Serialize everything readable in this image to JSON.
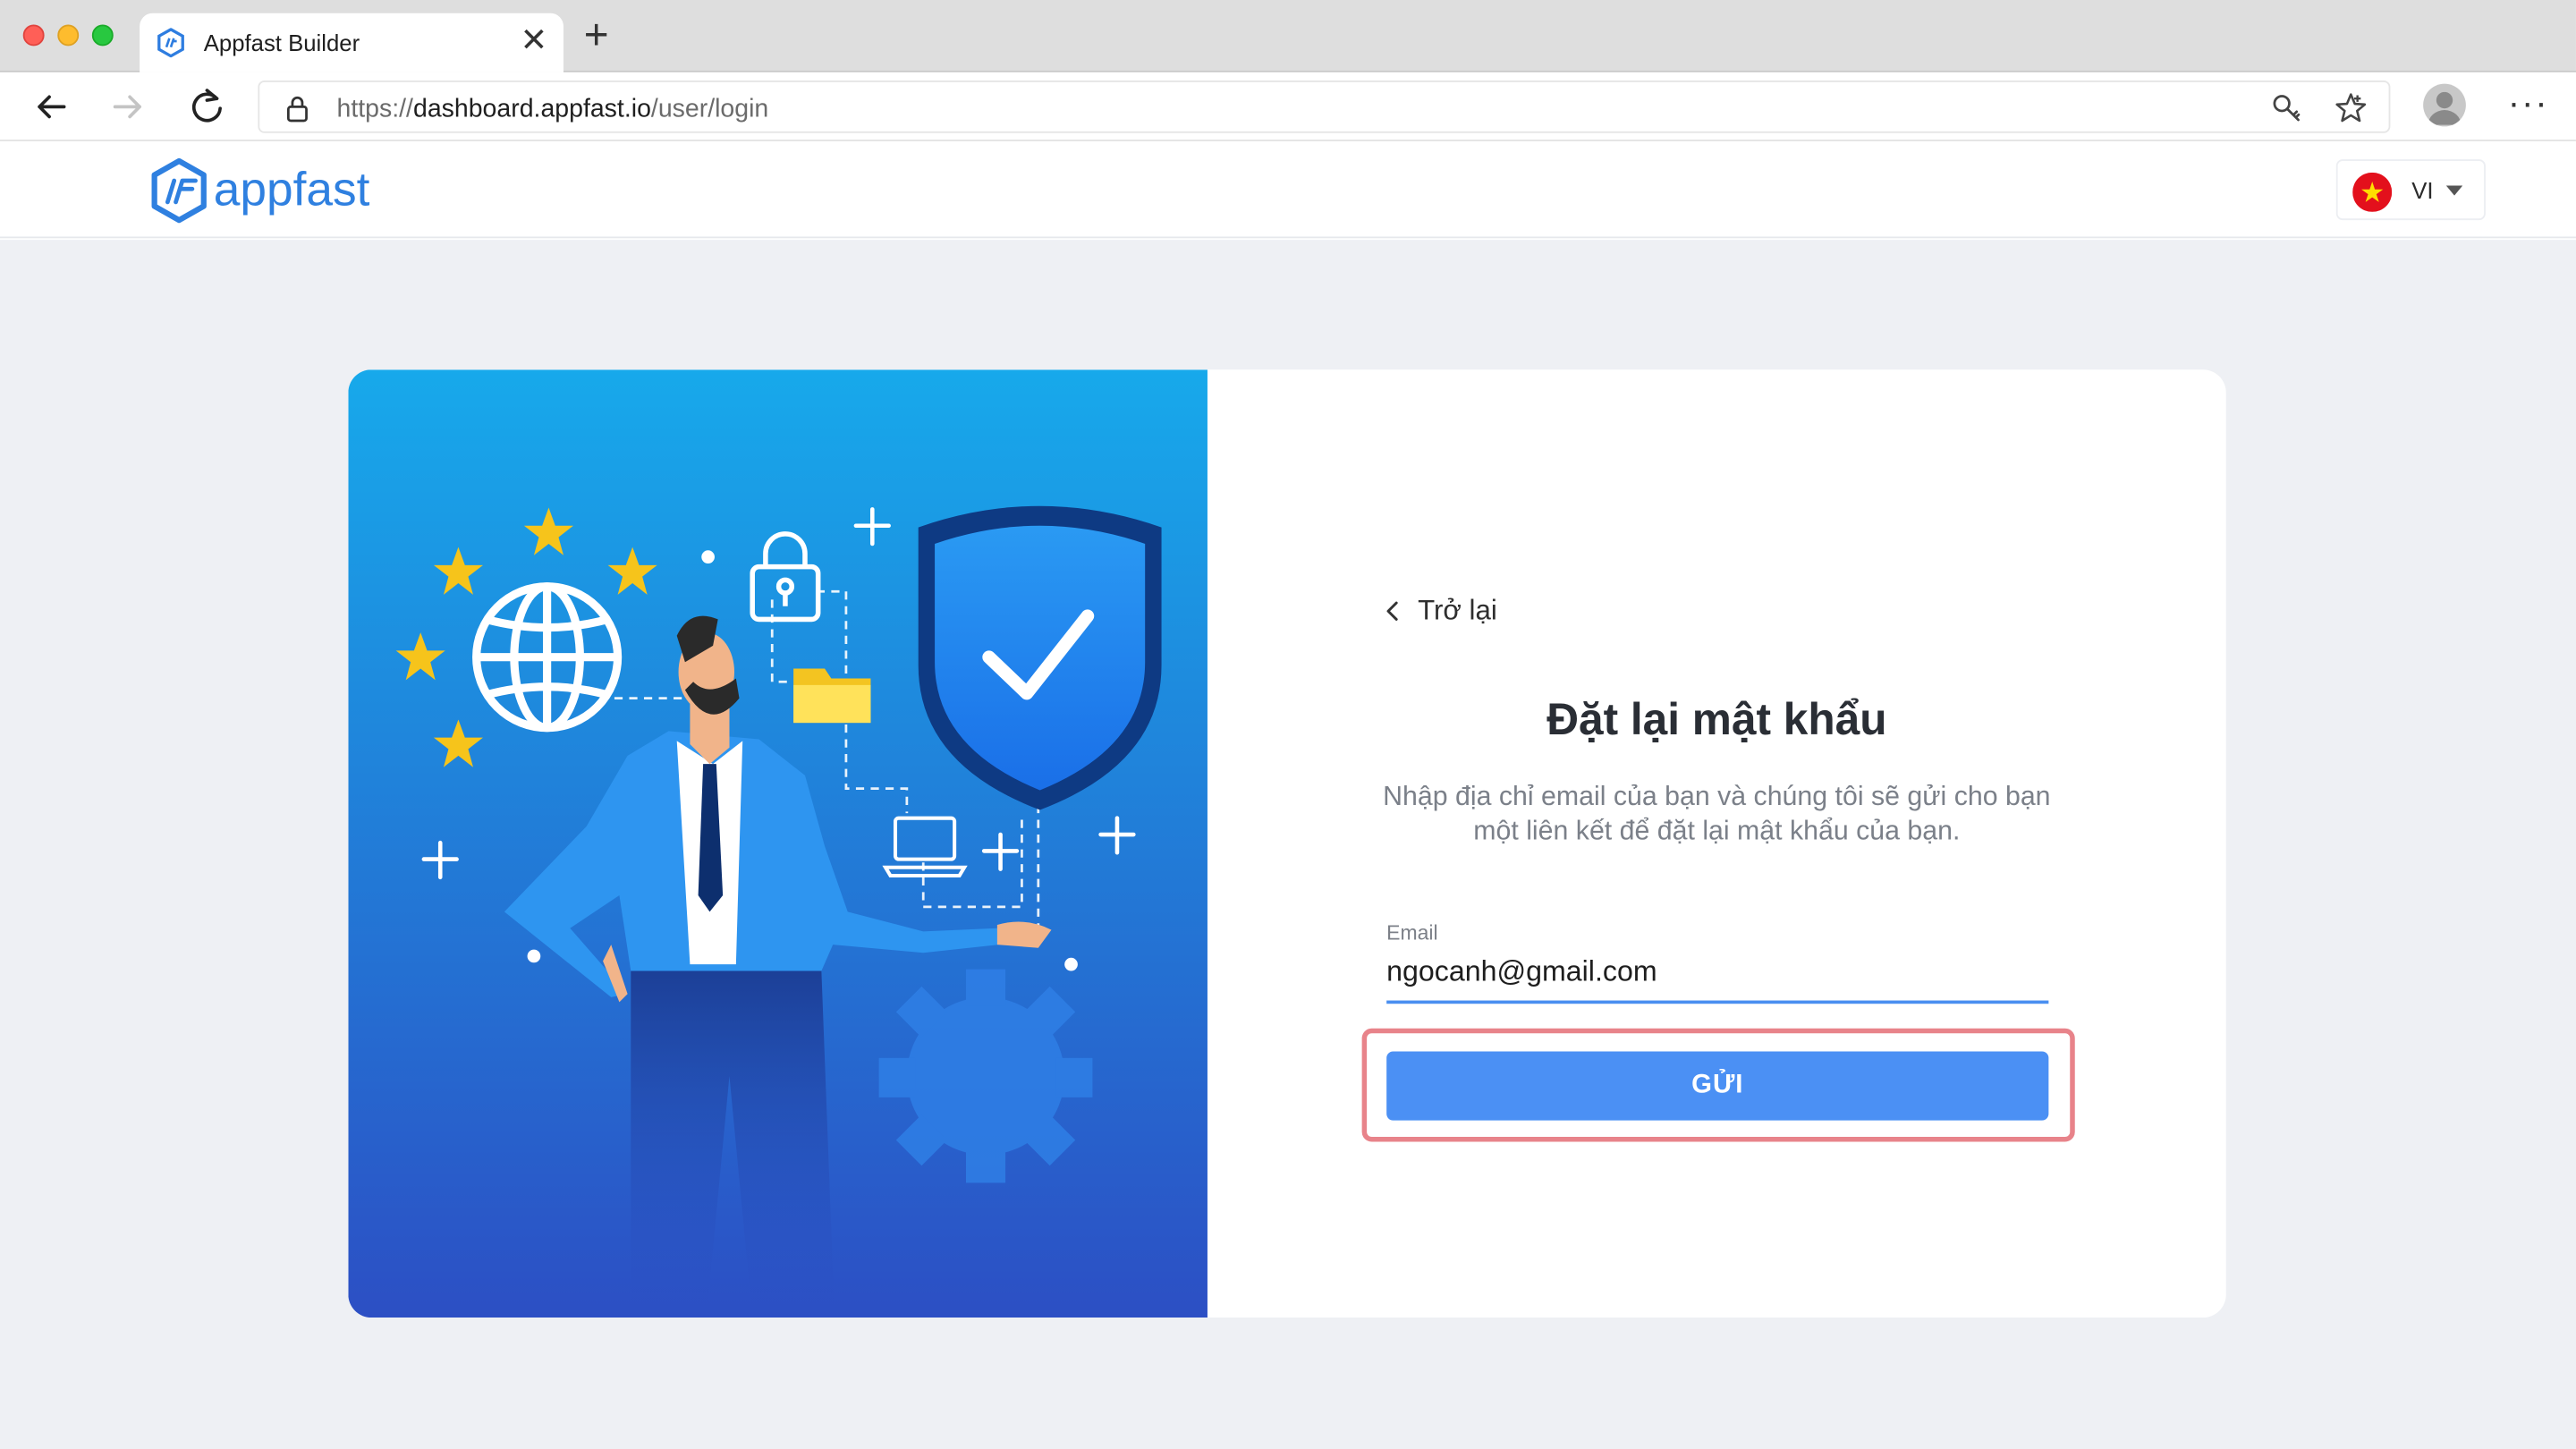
{
  "browser": {
    "tab_title": "Appfast Builder",
    "tab_close": "✕",
    "new_tab": "+",
    "url_prefix": "https://",
    "url_host": "dashboard.appfast.io",
    "url_path": "/user/login",
    "more": "···"
  },
  "header": {
    "logo_text": "appfast",
    "language": "VI"
  },
  "form": {
    "back_label": "Trở lại",
    "title": "Đặt lại mật khẩu",
    "description": "Nhập địa chỉ email của bạn và chúng tôi sẽ gửi cho bạn một liên kết để đặt lại mật khẩu của bạn.",
    "email_label": "Email",
    "email_value": "ngocanh@gmail.com",
    "submit_label": "GỬI"
  },
  "colors": {
    "accent": "#4b90f4",
    "highlight": "#e8838a",
    "page_bg": "#eef0f4"
  },
  "icons": [
    "close-icon",
    "back-arrow-icon",
    "forward-arrow-icon",
    "reload-icon",
    "lock-icon",
    "key-icon",
    "star-icon",
    "profile-icon",
    "flag-vietnam-icon",
    "chevron-left-icon"
  ]
}
